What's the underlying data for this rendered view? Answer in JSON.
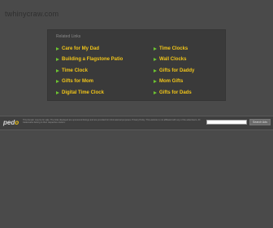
{
  "domain": "twhinycraw.com",
  "panel": {
    "heading": "Related Links",
    "left_links": [
      "Care for My Dad",
      "Building a Flagstone Patio",
      "Time Clock",
      "Gifts for Mom",
      "Digital Time Clock"
    ],
    "right_links": [
      "Time Clocks",
      "Wall Clocks",
      "Gifts for Daddy",
      "Mom Gifts",
      "Gifts for Dads"
    ]
  },
  "footer": {
    "logo_prefix": "ped",
    "logo_o": "o",
    "disclaimer": "This domain may be for sale. The links displayed are sponsored listings and are provided for informational purposes. Privacy Policy. This website is not affiliated with any of the advertisers. All trademarks belong to their respective owners.",
    "search_placeholder": "",
    "search_button": "Search Ads"
  },
  "colors": {
    "link": "#f0c419",
    "arrow": "#6ec431",
    "background": "#4a4a4a"
  }
}
